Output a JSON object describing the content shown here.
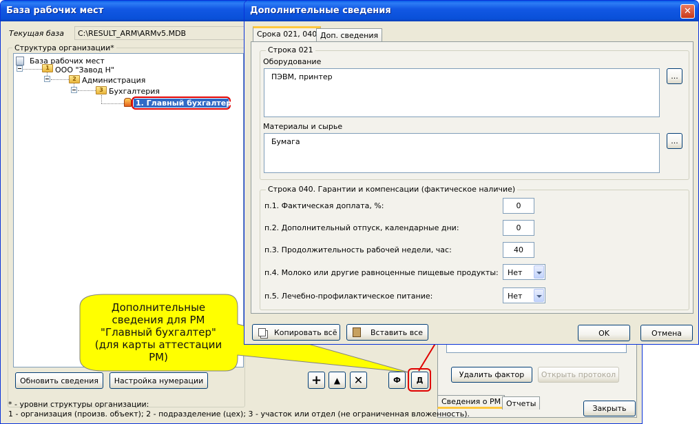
{
  "main_window": {
    "title": "База рабочих мест",
    "current_db_label": "Текущая база",
    "current_db_path": "C:\\RESULT_ARM\\ARMv5.MDB",
    "structure_label": "Структура организации*",
    "tree": {
      "root": "База рабочих мест",
      "org": "ООО \"Завод Н\"",
      "dept": "Администрация",
      "subdept": "Бухгалтерия",
      "workplace": "1. Главный бухгалтер",
      "level_org": "1",
      "level_dept": "2",
      "level_sub": "3"
    },
    "buttons": {
      "refresh": "Обновить сведения",
      "numbering": "Настройка нумерации",
      "add": "+",
      "up": "▲",
      "delete": "✕",
      "f": "Ф",
      "d": "Д",
      "delete_factor": "Удалить фактор",
      "open_protocol": "Открыть протокол",
      "close": "Закрыть"
    },
    "bottom_tabs": [
      "Сведения о РМ",
      "Отчеты"
    ],
    "footnote_line1": "* - уровни структуры организации:",
    "footnote_line2": "1 - организация (произв. объект); 2 - подразделение (цех); 3 - участок или отдел (не ограниченная вложенность)."
  },
  "callout": {
    "text": "Дополнительные сведения для РМ \"Главный бухгалтер\" (для карты аттестации РМ)",
    "color": "#ffff00"
  },
  "dialog": {
    "title": "Дополнительные сведения",
    "tabs": [
      "Срока 021, 040",
      "Доп. сведения"
    ],
    "row021": {
      "group_title": "Строка 021",
      "equipment_label": "Оборудование",
      "equipment_value": "ПЭВМ, принтер",
      "materials_label": "Материалы и сырье",
      "materials_value": "Бумага",
      "browse": "..."
    },
    "row040": {
      "group_title": "Строка 040.  Гарантии  и  компенсации (фактическое наличие)",
      "items": [
        {
          "label": "п.1. Фактическая доплата, %:",
          "value": "0"
        },
        {
          "label": "п.2. Дополнительный отпуск, календарные дни:",
          "value": "0"
        },
        {
          "label": "п.3. Продолжительность рабочей недели, час:",
          "value": "40"
        },
        {
          "label": "п.4. Молоко или другие равноценные пищевые продукты:",
          "value": "Нет"
        },
        {
          "label": "п.5. Лечебно-профилактическое питание:",
          "value": "Нет"
        }
      ]
    },
    "buttons": {
      "copy_all": "Копировать всё",
      "paste_all": "Вставить все",
      "ok": "OK",
      "cancel": "Отмена"
    }
  },
  "colors": {
    "highlight_red": "#e00000",
    "xp_title_blue": "#0a5ee8",
    "selection_blue": "#316ac5"
  }
}
